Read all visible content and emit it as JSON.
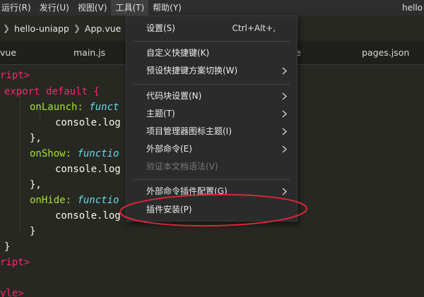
{
  "menubar": {
    "items": [
      "运行(R)",
      "发行(U)",
      "视图(V)",
      "工具(T)",
      "帮助(Y)"
    ],
    "window_title": "hello"
  },
  "breadcrumb": {
    "project": "hello-uniapp",
    "file": "App.vue"
  },
  "tabs": [
    "vue",
    "main.js",
    "e",
    "pages.json"
  ],
  "code": [
    "ript>",
    "export default {",
    "onLaunch:",
    "funct",
    "console.log",
    "},",
    "onShow:",
    "functio",
    "console.log",
    "},",
    "onHide:",
    "functio",
    "console.log",
    "}",
    "}",
    "ript>",
    "yle>"
  ],
  "tools_menu": {
    "settings": {
      "label": "设置(S)",
      "shortcut": "Ctrl+Alt+,"
    },
    "custom_keys": "自定义快捷键(K)",
    "preset_keys": "预设快捷键方案切换(W)",
    "snippets": "代码块设置(N)",
    "theme": "主题(T)",
    "project_icon_theme": "项目管理器图标主题(I)",
    "external_cmd": "外部命令(E)",
    "validate_doc": "验证本文档语法(V)",
    "external_plugin_config": "外部命令插件配置(G)",
    "plugin_install": "插件安装(P)"
  },
  "colors": {
    "highlight_circle": "#d9263a",
    "keyword": "#f92672",
    "function": "#a6e22e",
    "italic_type": "#66d9ef"
  }
}
